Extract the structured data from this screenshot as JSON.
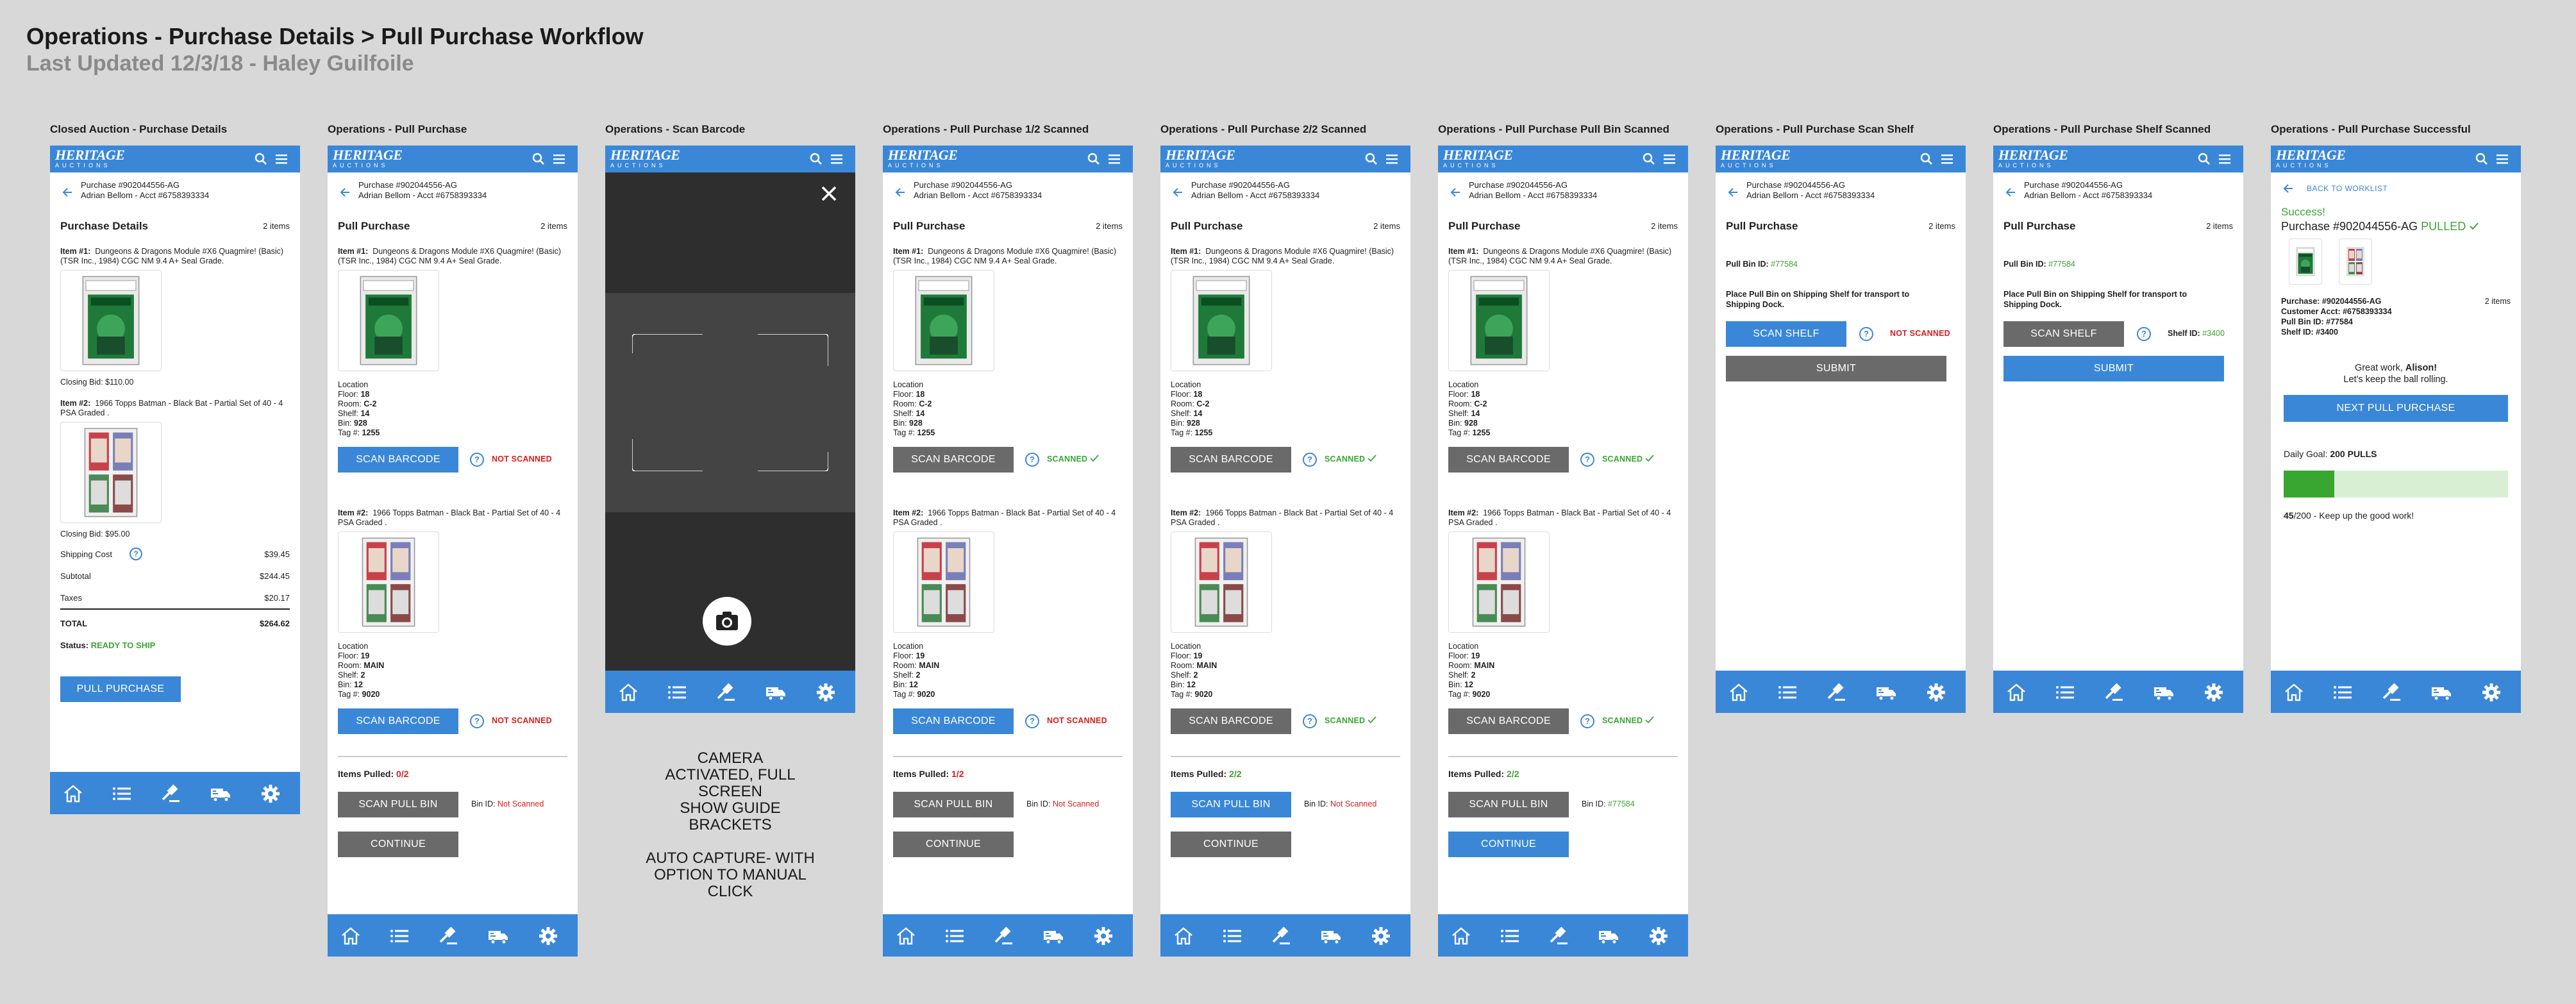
{
  "header": {
    "title": "Operations - Purchase Details > Pull Purchase Workflow",
    "subtitle": "Last Updated 12/3/18 - Haley Guilfoile"
  },
  "app": {
    "logo_line1": "HERITAGE",
    "logo_line2": "AUCTIONS",
    "brand_color": "#3a87d8",
    "accent_green": "#3aa632",
    "error_red": "#d81e1e"
  },
  "purchase": {
    "line1": "Purchase #902044556-AG",
    "line2": "Adrian Bellom - Acct #6758393334",
    "count": "2 items"
  },
  "labels": {
    "item1_prefix": "Item #1:",
    "item2_prefix": "Item #2:",
    "item1_desc": "Dungeons & Dragons Module #X6 Quagmire! (Basic) (TSR Inc., 1984) CGC NM 9.4 A+ Seal Grade.",
    "item2_desc": "1966 Topps Batman - Black Bat - Partial Set of 40 - 4 PSA Graded .",
    "location": "Location",
    "floor": "Floor:",
    "room": "Room:",
    "shelf": "Shelf:",
    "bin": "Bin:",
    "tag": "Tag #:",
    "scan_barcode": "SCAN BARCODE",
    "not_scanned": "NOT SCANNED",
    "scanned": "SCANNED",
    "items_pulled": "Items Pulled:",
    "scan_pull_bin": "SCAN PULL BIN",
    "bin_id": "Bin ID:",
    "not_scanned_sm": "Not Scanned",
    "continue": "CONTINUE",
    "pull_purchase": "Pull Purchase",
    "purchase_details": "Purchase Details",
    "qmark": "?"
  },
  "item1_loc": {
    "floor": "18",
    "room": "C-2",
    "shelf": "14",
    "bin": "928",
    "tag": "1255"
  },
  "item2_loc": {
    "floor": "19",
    "room": "MAIN",
    "shelf": "2",
    "bin": "12",
    "tag": "9020"
  },
  "screens": {
    "s1": {
      "title": "Closed Auction - Purchase Details",
      "closing_bid1": "Closing Bid: $110.00",
      "closing_bid2": "Closing Bid: $95.00",
      "shipping_label": "Shipping Cost",
      "shipping_val": "$39.45",
      "subtotal_label": "Subtotal",
      "subtotal_val": "$244.45",
      "taxes_label": "Taxes",
      "taxes_val": "$20.17",
      "total_label": "TOTAL",
      "total_val": "$264.62",
      "status_label": "Status:",
      "status_val": "READY TO SHIP",
      "button": "PULL PURCHASE"
    },
    "s2": {
      "title": "Operations - Pull Purchase",
      "pulled": "0/2"
    },
    "s3": {
      "title": "Operations - Scan Barcode",
      "note1": "CAMERA ACTIVATED, FULL SCREEN",
      "note2": "SHOW GUIDE BRACKETS",
      "note3": "AUTO CAPTURE- WITH OPTION TO MANUAL CLICK"
    },
    "s4": {
      "title": "Operations - Pull Purchase 1/2 Scanned",
      "pulled": "1/2"
    },
    "s5": {
      "title": "Operations - Pull Purchase 2/2 Scanned",
      "pulled": "2/2"
    },
    "s6": {
      "title": "Operations - Pull Purchase Pull Bin Scanned",
      "pulled": "2/2",
      "bin_val": "#77584"
    },
    "s7": {
      "title": "Operations - Pull Purchase Scan Shelf",
      "pull_bin_label": "Pull Bin ID:",
      "pull_bin_val": "#77584",
      "instruction": "Place Pull Bin on Shipping Shelf for transport to Shipping Dock.",
      "scan_shelf": "SCAN SHELF",
      "submit": "SUBMIT"
    },
    "s8": {
      "title": "Operations - Pull Purchase Shelf Scanned",
      "shelf_label": "Shelf ID:",
      "shelf_val": "#3400"
    },
    "s9": {
      "title": "Operations - Pull Purchase Successful",
      "back": "BACK TO WORKLIST",
      "success": "Success!",
      "pulled_line": "Purchase #902044556-AG",
      "pulled_word": "PULLED",
      "purchase_line": "Purchase: #902044556-AG",
      "count": "2 items",
      "customer_line": "Customer Acct: #6758393334",
      "bin_line": "Pull Bin ID: #77584",
      "shelf_line": "Shelf ID: #3400",
      "great_work": "Great work,",
      "name": "Alison!",
      "keep_rolling": "Let's keep the ball rolling.",
      "next": "NEXT PULL PURCHASE",
      "goal_label": "Daily Goal:",
      "goal_val": "200 PULLS",
      "progress_current": "45",
      "progress_total": "/200",
      "progress_fraction": 0.225,
      "progress_msg": " - Keep up the good work!"
    }
  },
  "icons": {
    "appbar": [
      "search-icon",
      "menu-icon"
    ],
    "tabs": [
      "home-icon",
      "list-icon",
      "gavel-icon",
      "truck-icon",
      "gear-icon"
    ]
  }
}
